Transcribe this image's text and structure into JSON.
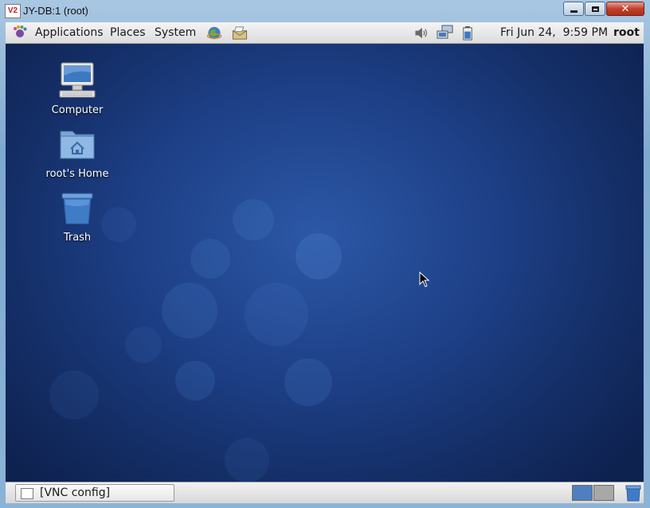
{
  "window": {
    "title": "JY-DB:1 (root)",
    "app_icon_text": "V2",
    "buttons": [
      "minimize",
      "maximize",
      "close"
    ]
  },
  "top_panel": {
    "menus": [
      "Applications",
      "Places",
      "System"
    ],
    "clock": "Fri Jun 24,  9:59 PM",
    "user": "root",
    "launchers": [
      "web-browser-icon",
      "mail-client-icon"
    ],
    "tray_icons": [
      "volume-icon",
      "network-icon",
      "battery-icon"
    ]
  },
  "desktop": {
    "icons": [
      {
        "label": "Computer",
        "icon": "computer-icon"
      },
      {
        "label": "root's Home",
        "icon": "home-folder-icon"
      },
      {
        "label": "Trash",
        "icon": "trash-icon"
      }
    ]
  },
  "bottom_panel": {
    "task": "[VNC config]",
    "workspaces": 2,
    "active_workspace": 1
  },
  "colors": {
    "desktop_blue": "#1d3f86",
    "panel_gray": "#dcdcdc",
    "workspace_active": "#4f7fc0"
  }
}
